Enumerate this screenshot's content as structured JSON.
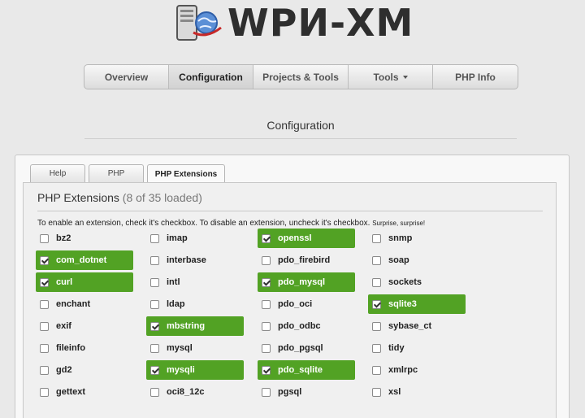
{
  "app": {
    "logo_text": "WPИ-XM"
  },
  "nav": {
    "items": [
      {
        "label": "Overview",
        "active": false,
        "dropdown": false
      },
      {
        "label": "Configuration",
        "active": true,
        "dropdown": false
      },
      {
        "label": "Projects & Tools",
        "active": false,
        "dropdown": false
      },
      {
        "label": "Tools",
        "active": false,
        "dropdown": true
      },
      {
        "label": "PHP Info",
        "active": false,
        "dropdown": false
      }
    ]
  },
  "page": {
    "title": "Configuration"
  },
  "tabs": [
    {
      "label": "Help",
      "active": false
    },
    {
      "label": "PHP",
      "active": false
    },
    {
      "label": "PHP Extensions",
      "active": true
    }
  ],
  "extensions_panel": {
    "heading": "PHP Extensions",
    "count_text": "(8 of 35 loaded)",
    "instructions": "To enable an extension, check it's checkbox. To disable an extension, uncheck it's checkbox.",
    "instructions_small": "Surprise, surprise!",
    "columns": [
      [
        {
          "name": "bz2",
          "enabled": false
        },
        {
          "name": "com_dotnet",
          "enabled": true
        },
        {
          "name": "curl",
          "enabled": true
        },
        {
          "name": "enchant",
          "enabled": false
        },
        {
          "name": "exif",
          "enabled": false
        },
        {
          "name": "fileinfo",
          "enabled": false
        },
        {
          "name": "gd2",
          "enabled": false
        },
        {
          "name": "gettext",
          "enabled": false
        }
      ],
      [
        {
          "name": "imap",
          "enabled": false
        },
        {
          "name": "interbase",
          "enabled": false
        },
        {
          "name": "intl",
          "enabled": false
        },
        {
          "name": "ldap",
          "enabled": false
        },
        {
          "name": "mbstring",
          "enabled": true
        },
        {
          "name": "mysql",
          "enabled": false
        },
        {
          "name": "mysqli",
          "enabled": true
        },
        {
          "name": "oci8_12c",
          "enabled": false
        }
      ],
      [
        {
          "name": "openssl",
          "enabled": true
        },
        {
          "name": "pdo_firebird",
          "enabled": false
        },
        {
          "name": "pdo_mysql",
          "enabled": true
        },
        {
          "name": "pdo_oci",
          "enabled": false
        },
        {
          "name": "pdo_odbc",
          "enabled": false
        },
        {
          "name": "pdo_pgsql",
          "enabled": false
        },
        {
          "name": "pdo_sqlite",
          "enabled": true
        },
        {
          "name": "pgsql",
          "enabled": false
        }
      ],
      [
        {
          "name": "snmp",
          "enabled": false
        },
        {
          "name": "soap",
          "enabled": false
        },
        {
          "name": "sockets",
          "enabled": false
        },
        {
          "name": "sqlite3",
          "enabled": true
        },
        {
          "name": "sybase_ct",
          "enabled": false
        },
        {
          "name": "tidy",
          "enabled": false
        },
        {
          "name": "xmlrpc",
          "enabled": false
        },
        {
          "name": "xsl",
          "enabled": false
        }
      ]
    ]
  },
  "colors": {
    "enabled_bg": "#52a224",
    "background": "#e9e9e9",
    "logo_text": "#2e2e2e"
  },
  "icons": {
    "logo": "server-globe-icon",
    "dropdown": "caret-down-icon"
  }
}
